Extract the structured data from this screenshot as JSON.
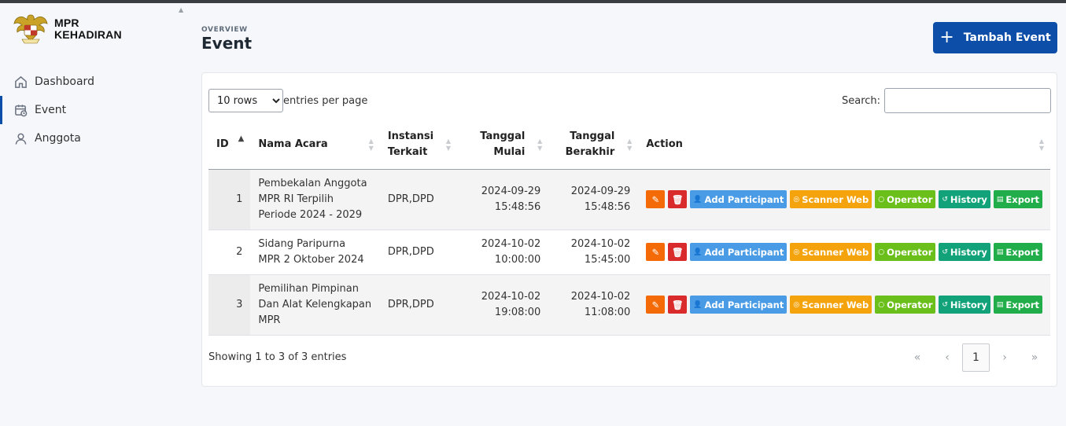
{
  "brand": {
    "line1": "MPR",
    "line2": "KEHADIRAN"
  },
  "nav": [
    {
      "label": "Dashboard",
      "icon": "home-icon"
    },
    {
      "label": "Event",
      "icon": "calendar-clock-icon",
      "active": true
    },
    {
      "label": "Anggota",
      "icon": "user-icon"
    }
  ],
  "header": {
    "overline": "OVERVIEW",
    "title": "Event",
    "add_button": "Tambah Event"
  },
  "table_controls": {
    "rows_selected": "10 rows",
    "rows_options": [
      "10 rows"
    ],
    "per_page_label": "entries per page",
    "search_label": "Search:",
    "search_value": ""
  },
  "columns": {
    "id": "ID",
    "nama": "Nama Acara",
    "instansi_1": "Instansi",
    "instansi_2": "Terkait",
    "mulai_1": "Tanggal",
    "mulai_2": "Mulai",
    "akhir_1": "Tanggal",
    "akhir_2": "Berakhir",
    "action": "Action"
  },
  "action_labels": {
    "add": "Add Participant",
    "scan": "Scanner Web",
    "op": "Operator",
    "hist": "History",
    "exp": "Export"
  },
  "rows": [
    {
      "id": "1",
      "nama_1": "Pembekalan Anggota",
      "nama_2": "MPR RI Terpilih",
      "nama_3": "Periode 2024 - 2029",
      "instansi": "DPR,DPD",
      "mulai_date": "2024-09-29",
      "mulai_time": "15:48:56",
      "akhir_date": "2024-09-29",
      "akhir_time": "15:48:56"
    },
    {
      "id": "2",
      "nama_1": "Sidang Paripurna",
      "nama_2": "MPR 2 Oktober 2024",
      "nama_3": "",
      "instansi": "DPR,DPD",
      "mulai_date": "2024-10-02",
      "mulai_time": "10:00:00",
      "akhir_date": "2024-10-02",
      "akhir_time": "15:45:00"
    },
    {
      "id": "3",
      "nama_1": "Pemilihan Pimpinan",
      "nama_2": "Dan Alat Kelengkapan",
      "nama_3": "MPR",
      "instansi": "DPR,DPD",
      "mulai_date": "2024-10-02",
      "mulai_time": "19:08:00",
      "akhir_date": "2024-10-02",
      "akhir_time": "11:08:00"
    }
  ],
  "footer": {
    "showing": "Showing 1 to 3 of 3 entries",
    "first": "«",
    "prev": "‹",
    "page": "1",
    "next": "›",
    "last": "»"
  },
  "colors": {
    "primary": "#0d4fa8",
    "edit": "#f46a06",
    "delete": "#d92b2b",
    "add_participant": "#4a9be6",
    "scanner": "#f5a30d",
    "operator": "#6bbf1a",
    "history": "#12a27a",
    "export": "#22ad4b"
  }
}
